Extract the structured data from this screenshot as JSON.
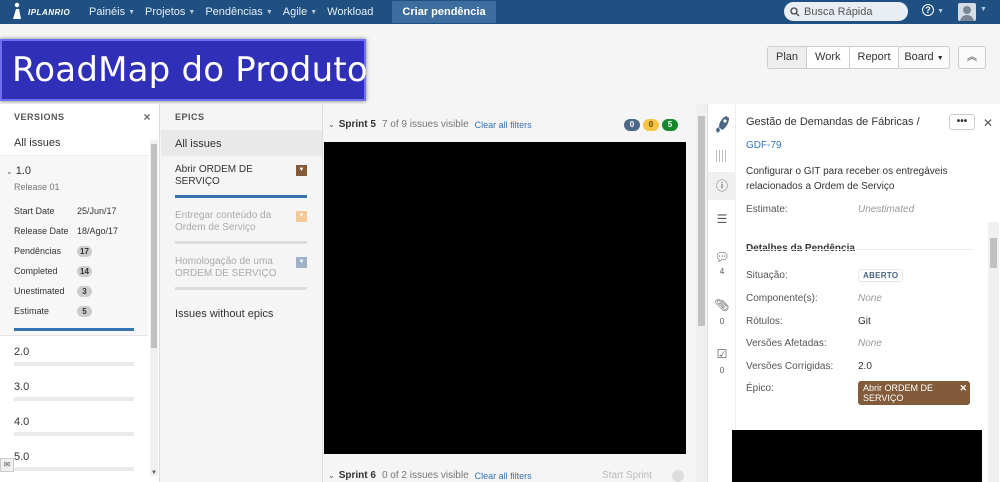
{
  "nav": {
    "logo_text": "IPLANRIO",
    "items": [
      {
        "label": "Painéis",
        "caret": true
      },
      {
        "label": "Projetos",
        "caret": true
      },
      {
        "label": "Pendências",
        "caret": true
      },
      {
        "label": "Agile",
        "caret": true
      },
      {
        "label": "Workload",
        "caret": false
      }
    ],
    "create_label": "Criar pendência",
    "search_placeholder": "Busca Rápida",
    "help_label": "?"
  },
  "banner": {
    "title": "RoadMap do Produto"
  },
  "header": {
    "modes": [
      "Plan",
      "Work",
      "Report"
    ],
    "active_mode": "Plan",
    "board_label": "Board",
    "collapse_label": "«"
  },
  "versions": {
    "heading": "VERSIONS",
    "all_issues": "All issues",
    "expanded": {
      "name": "1.0",
      "release_name": "Release 01",
      "start_date_label": "Start Date",
      "start_date": "25/Jun/17",
      "release_date_label": "Release Date",
      "release_date": "18/Ago/17",
      "pendencias_label": "Pendências",
      "pendencias": "17",
      "completed_label": "Completed",
      "completed": "14",
      "unestimated_label": "Unestimated",
      "unestimated": "3",
      "estimate_label": "Estimate",
      "estimate": "5"
    },
    "others": [
      "2.0",
      "3.0",
      "4.0",
      "5.0"
    ]
  },
  "epics": {
    "heading": "EPICS",
    "all_issues": "All issues",
    "items": [
      {
        "name": "Abrir ORDEM DE SERVIÇO",
        "color": "#815b3a",
        "dim": false
      },
      {
        "name": "Entregar conteúdo da Ordem de Serviço",
        "color": "#f79232",
        "dim": true
      },
      {
        "name": "Homologação de uma ORDEM DE SERVIÇO",
        "color": "#4a6785",
        "dim": true
      }
    ],
    "no_epic": "Issues without epics"
  },
  "backlog": {
    "sprint5": {
      "name": "Sprint 5",
      "visible": "7 of 9 issues visible",
      "clear": "Clear all filters",
      "todo": "0",
      "in_progress": "0",
      "done": "5"
    },
    "sprint6": {
      "name": "Sprint 6",
      "visible": "0 of 2 issues visible",
      "clear": "Clear all filters",
      "start": "Start Sprint"
    }
  },
  "detail": {
    "project": "Gestão de Demandas de Fábricas /",
    "key": "GDF-79",
    "summary": "Configurar o GIT para receber os entregáveis relacionados a Ordem de Serviço",
    "estimate_label": "Estimate:",
    "estimate_value": "Unestimated",
    "section": "Detalhes da Pendência",
    "fields": {
      "situacao_label": "Situação:",
      "situacao_value": "ABERTO",
      "componentes_label": "Componente(s):",
      "componentes_value": "None",
      "rotulos_label": "Rótulos:",
      "rotulos_value": "Git",
      "versoes_afetadas_label": "Versões Afetadas:",
      "versoes_afetadas_value": "None",
      "versoes_corrigidas_label": "Versões Corrigidas:",
      "versoes_corrigidas_value": "2.0",
      "epico_label": "Épico:",
      "epico_value": "Abrir ORDEM DE SERVIÇO"
    },
    "rail_counts": {
      "comments": "4",
      "attachments": "0",
      "subtasks": "0"
    }
  }
}
